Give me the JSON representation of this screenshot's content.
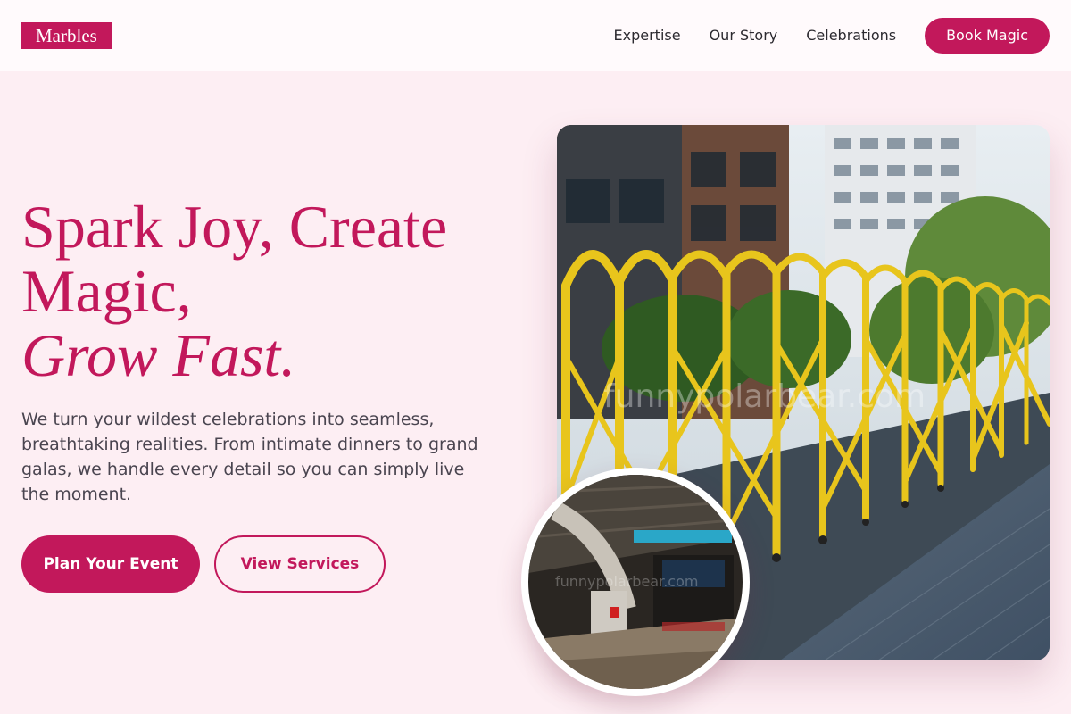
{
  "header": {
    "logo": "Marbles",
    "nav": [
      "Expertise",
      "Our Story",
      "Celebrations"
    ],
    "cta": "Book Magic"
  },
  "hero": {
    "title_line1": "Spark Joy, Create",
    "title_line2": "Magic,",
    "title_line3": "Grow Fast.",
    "description": "We turn your wildest celebrations into seamless, breathtaking realities. From intimate dinners to grand galas, we handle every detail so you can simply live the moment.",
    "primary_button": "Plan Your Event",
    "secondary_button": "View Services"
  },
  "images": {
    "main_watermark": "funnypolarbear.com",
    "circle_watermark": "funnypolarbear.com"
  },
  "colors": {
    "accent": "#c2185b",
    "background": "#fdeef3",
    "header_bg": "#fffafc"
  }
}
